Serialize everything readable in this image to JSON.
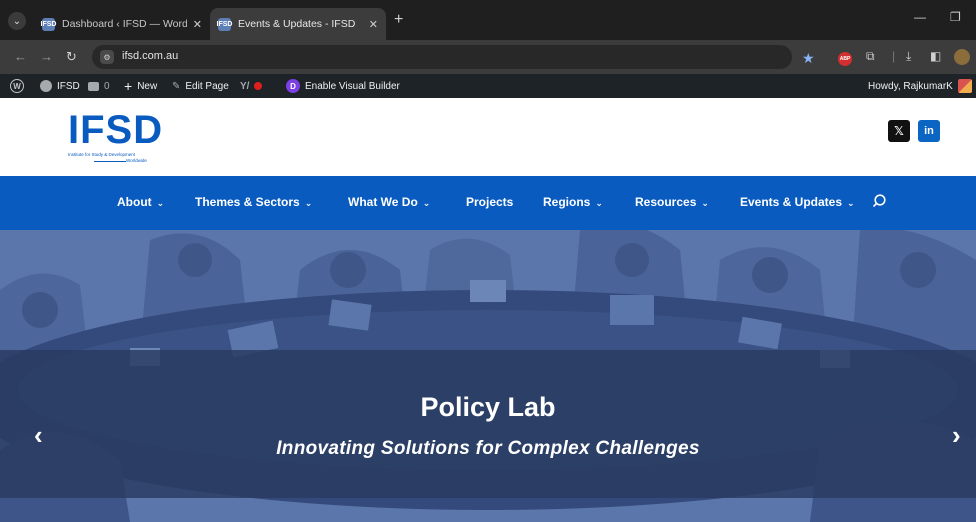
{
  "browser": {
    "tabs": [
      {
        "favicon": "IFSD",
        "title": "Dashboard ‹ IFSD — WordPress",
        "active": false
      },
      {
        "favicon": "IFSD",
        "title": "Events & Updates - IFSD",
        "active": true
      }
    ],
    "url": "ifsd.com.au"
  },
  "adminbar": {
    "site_name": "IFSD",
    "comments_count": "0",
    "new_label": "New",
    "edit_label": "Edit Page",
    "builder_label": "Enable Visual Builder",
    "howdy": "Howdy, RajkumarK"
  },
  "site": {
    "logo_text": "IFSD",
    "logo_tagline": "Institute for Study & Development",
    "logo_tagline2": "Worldwide",
    "social": {
      "x": "𝕏",
      "linkedin": "in"
    }
  },
  "nav": {
    "items": [
      {
        "label": "About",
        "dropdown": true
      },
      {
        "label": "Themes & Sectors",
        "dropdown": true
      },
      {
        "label": "What We Do",
        "dropdown": true
      },
      {
        "label": "Projects",
        "dropdown": false
      },
      {
        "label": "Regions",
        "dropdown": true
      },
      {
        "label": "Resources",
        "dropdown": true
      },
      {
        "label": "Events & Updates",
        "dropdown": true
      }
    ],
    "chevron": "⌄"
  },
  "hero": {
    "title": "Policy Lab",
    "subtitle": "Innovating Solutions for Complex Challenges",
    "prev": "‹",
    "next": "›"
  },
  "colors": {
    "brand_blue": "#0a5bbf",
    "admin_bar": "#1d2327",
    "hero_bg": "#5670a4"
  }
}
